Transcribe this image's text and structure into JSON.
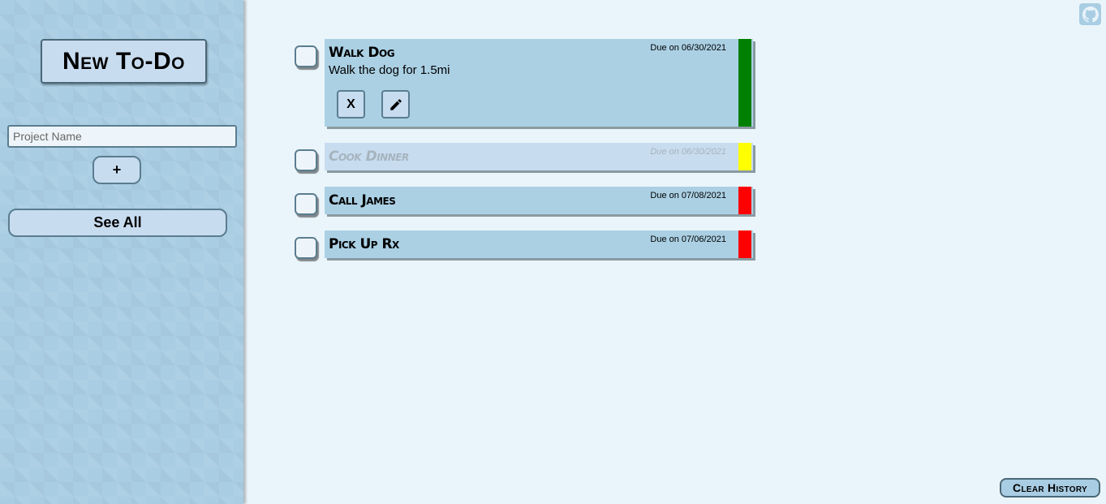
{
  "sidebar": {
    "new_todo_label": "New To-Do",
    "project_placeholder": "Project Name",
    "project_value": "",
    "add_label": "+",
    "see_all_label": "See All"
  },
  "todos": [
    {
      "title": "Walk Dog",
      "due": "Due on 06/30/2021",
      "description": "Walk the dog for 1.5mi",
      "priority_color": "#008000",
      "completed": false,
      "expanded": true,
      "delete_label": "X",
      "edit_icon": "pencil-icon"
    },
    {
      "title": "Cook Dinner",
      "due": "Due on 06/30/2021",
      "priority_color": "#ffff00",
      "completed": true
    },
    {
      "title": "Call James",
      "due": "Due on 07/08/2021",
      "priority_color": "#ff0000",
      "completed": false
    },
    {
      "title": "Pick Up Rx",
      "due": "Due on 07/06/2021",
      "priority_color": "#ff0000",
      "completed": false
    }
  ],
  "footer": {
    "clear_history_label": "Clear History",
    "github_icon": "github-icon"
  },
  "colors": {
    "sidebar_bg": "#a9cde3",
    "main_bg": "#eaf5fb",
    "card_bg": "#abd0e4",
    "button_bg": "#c8dcf0"
  }
}
